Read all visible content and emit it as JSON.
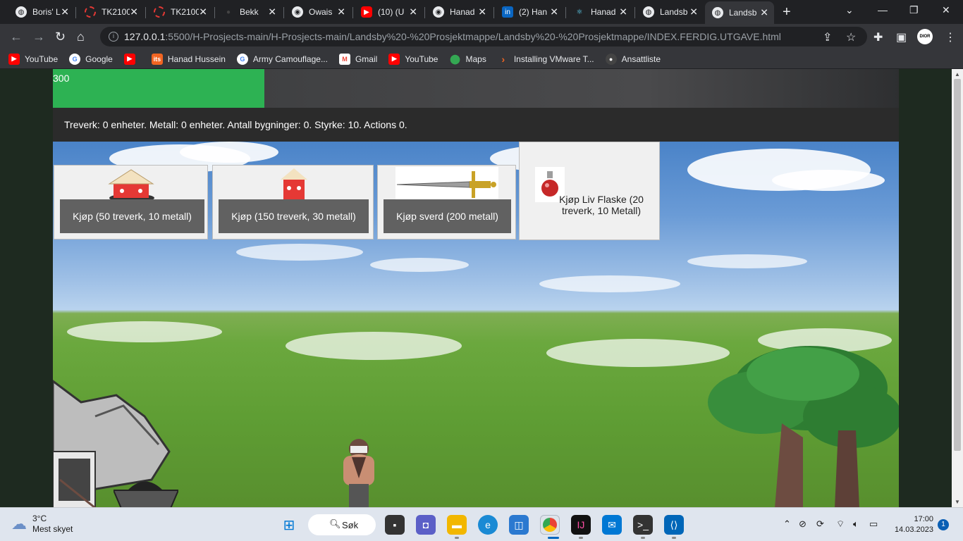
{
  "browser": {
    "tabs": [
      {
        "title": "Boris' L",
        "favicon": "globe-icon"
      },
      {
        "title": "TK2100",
        "favicon": "ring-icon"
      },
      {
        "title": "TK2100",
        "favicon": "ring-icon"
      },
      {
        "title": "Bekk",
        "favicon": "dot-icon"
      },
      {
        "title": "Owais",
        "favicon": "github-icon"
      },
      {
        "title": "(10) (U",
        "favicon": "youtube-icon"
      },
      {
        "title": "Hanad",
        "favicon": "github-icon"
      },
      {
        "title": "(2) Han",
        "favicon": "linkedin-icon"
      },
      {
        "title": "Hanad",
        "favicon": "react-icon"
      },
      {
        "title": "Landsb",
        "favicon": "globe-icon"
      },
      {
        "title": "Landsb",
        "favicon": "globe-icon",
        "active": true
      }
    ],
    "url_host": "127.0.0.1",
    "url_path": ":5500/H-Prosjects-main/H-Prosjects-main/Landsby%20-%20Prosjektmappe/Landsby%20-%20Prosjektmappe/INDEX.FERDIG.UTGAVE.html",
    "profile_label": "DIOR",
    "bookmarks": [
      {
        "label": "YouTube",
        "icon": "youtube-icon",
        "color": "#ff0000"
      },
      {
        "label": "Google",
        "icon": "google-icon",
        "color": "#ffffff"
      },
      {
        "label": "",
        "icon": "youtube-icon",
        "color": "#ff0000"
      },
      {
        "label": "Hanad Hussein",
        "icon": "its-icon",
        "color": "#f26522"
      },
      {
        "label": "Army Camouflage...",
        "icon": "google-icon",
        "color": "#ffffff"
      },
      {
        "label": "Gmail",
        "icon": "gmail-icon",
        "color": "#ffffff"
      },
      {
        "label": "YouTube",
        "icon": "youtube-icon",
        "color": "#ff0000"
      },
      {
        "label": "Maps",
        "icon": "maps-icon",
        "color": "#34a853"
      },
      {
        "label": "Installing VMware T...",
        "icon": "chevron-icon",
        "color": "#f26522"
      },
      {
        "label": "Ansattliste",
        "icon": "avatar-icon",
        "color": "#555555"
      }
    ]
  },
  "game": {
    "health_value": "300",
    "health_fraction": 0.25,
    "stats_text": "Treverk: 0 enheter. Metall: 0 enheter. Antall bygninger: 0. Styrke: 10. Actions 0.",
    "shop": [
      {
        "label": "Kjøp (50 treverk, 10 metall)",
        "icon": "hut-icon"
      },
      {
        "label": "Kjøp (150 treverk, 30 metall)",
        "icon": "tower-icon"
      },
      {
        "label": "Kjøp sverd (200 metall)",
        "icon": "sword-icon"
      }
    ],
    "potion_label": "Kjøp Liv Flaske (20 treverk, 10 Metall)"
  },
  "taskbar": {
    "weather_temp": "3°C",
    "weather_desc": "Mest skyet",
    "search_label": "Søk",
    "time": "17:00",
    "date": "14.03.2023",
    "notification_count": "1"
  }
}
